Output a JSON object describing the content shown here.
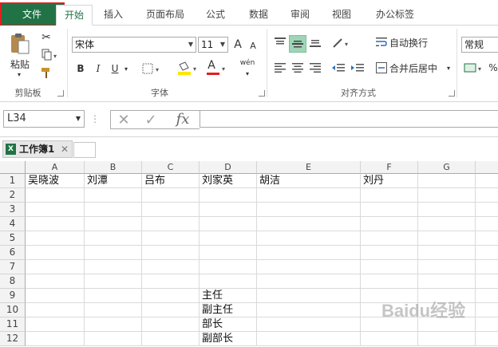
{
  "ribbon_tabs": [
    "文件",
    "开始",
    "插入",
    "页面布局",
    "公式",
    "数据",
    "审阅",
    "视图",
    "办公标签"
  ],
  "clipboard": {
    "paste_label": "粘贴",
    "group_label": "剪贴板"
  },
  "font": {
    "name": "宋体",
    "size": "11",
    "bold": "B",
    "italic": "I",
    "underline": "U",
    "grow": "A",
    "shrink": "A",
    "color_letter": "A",
    "fill_icon": "paint-bucket-icon",
    "phonetic": "wén",
    "group_label": "字体"
  },
  "alignment": {
    "wrap_label": "自动换行",
    "merge_label": "合并后居中",
    "group_label": "对齐方式"
  },
  "number": {
    "format": "常规"
  },
  "formula_bar": {
    "name_box": "L34",
    "fx": "fx",
    "value": ""
  },
  "workbook": {
    "tab_label": "工作簿1",
    "icon_letter": "X"
  },
  "grid": {
    "columns": [
      "A",
      "B",
      "C",
      "D",
      "E",
      "F",
      "G"
    ],
    "rows": [
      "1",
      "2",
      "3",
      "4",
      "5",
      "6",
      "7",
      "8",
      "9",
      "10",
      "11",
      "12"
    ],
    "row1": [
      "吴晓波",
      "刘潭",
      "吕布",
      "刘家英",
      "胡洁",
      "刘丹",
      ""
    ],
    "d9": "主任",
    "d10": "副主任",
    "d11": "部长",
    "d12": "副部长"
  },
  "watermark": "Baidu经验",
  "colors": {
    "accent": "#217346",
    "file_outline": "#e02020"
  }
}
